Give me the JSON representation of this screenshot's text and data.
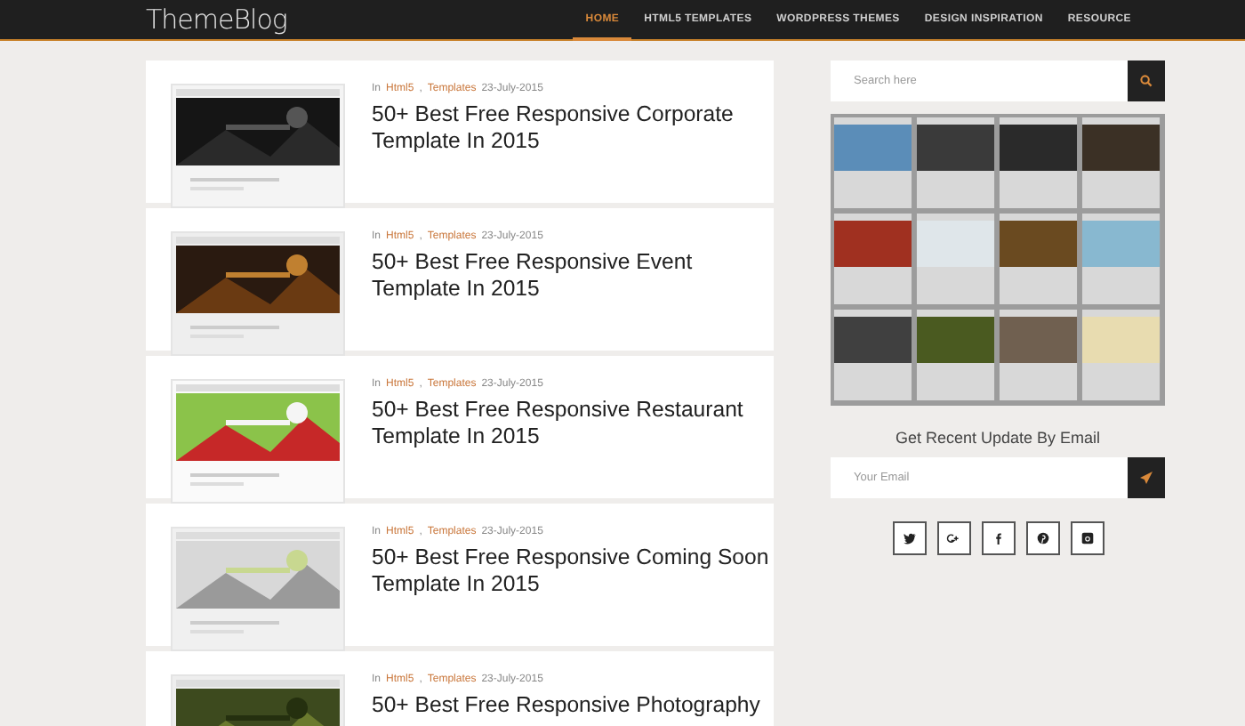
{
  "header": {
    "logo": "ThemeBlog",
    "nav": [
      {
        "label": "HOME",
        "selected": true
      },
      {
        "label": "HTML5 TEMPLATES",
        "selected": false
      },
      {
        "label": "WORDPRESS THEMES",
        "selected": false
      },
      {
        "label": "DESIGN INSPIRATION",
        "selected": false
      },
      {
        "label": "RESOURCE",
        "selected": false
      }
    ]
  },
  "posts": [
    {
      "prefix": "In",
      "categories": [
        "Html5",
        "Templates"
      ],
      "separator": ",",
      "date": "23-July-2015",
      "title": "50+ Best Free Responsive Corporate Template In 2015"
    },
    {
      "prefix": "In",
      "categories": [
        "Html5",
        "Templates"
      ],
      "separator": ",",
      "date": "23-July-2015",
      "title": "50+ Best Free Responsive Event Template In 2015"
    },
    {
      "prefix": "In",
      "categories": [
        "Html5",
        "Templates"
      ],
      "separator": ",",
      "date": "23-July-2015",
      "title": "50+ Best Free Responsive Restaurant Template In 2015"
    },
    {
      "prefix": "In",
      "categories": [
        "Html5",
        "Templates"
      ],
      "separator": ",",
      "date": "23-July-2015",
      "title": "50+ Best Free Responsive Coming Soon Template In 2015"
    },
    {
      "prefix": "In",
      "categories": [
        "Html5",
        "Templates"
      ],
      "separator": ",",
      "date": "23-July-2015",
      "title": "50+ Best Free Responsive Photography"
    }
  ],
  "sidebar": {
    "search": {
      "placeholder": "Search here"
    },
    "subscribe": {
      "heading": "Get Recent Update By Email",
      "placeholder": "Your Email"
    },
    "social": [
      {
        "kind": "twitter"
      },
      {
        "kind": "google-plus"
      },
      {
        "kind": "facebook"
      },
      {
        "kind": "pinterest"
      },
      {
        "kind": "instagram"
      }
    ]
  }
}
